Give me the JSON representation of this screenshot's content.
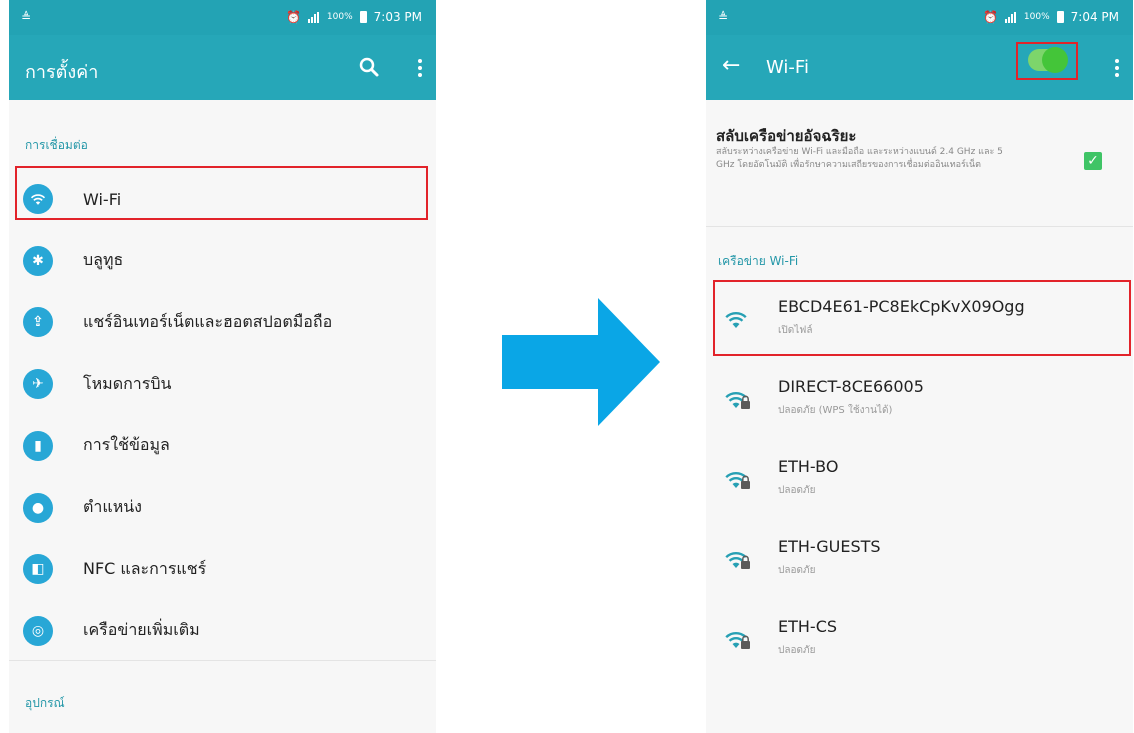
{
  "left": {
    "status_time": "7:03 PM",
    "battery": "100%",
    "title": "การตั้งค่า",
    "section_connections": "การเชื่อมต่อ",
    "items": [
      {
        "label": "Wi-Fi",
        "icon": "wifi-icon"
      },
      {
        "label": "บลูทูธ",
        "icon": "bluetooth-icon"
      },
      {
        "label": "แชร์อินเทอร์เน็ตและฮอตสปอตมือถือ",
        "icon": "tethering-icon"
      },
      {
        "label": "โหมดการบิน",
        "icon": "airplane-icon"
      },
      {
        "label": "การใช้ข้อมูล",
        "icon": "data-usage-icon"
      },
      {
        "label": "ตำแหน่ง",
        "icon": "location-icon"
      },
      {
        "label": "NFC และการแชร์",
        "icon": "nfc-icon"
      },
      {
        "label": "เครือข่ายเพิ่มเติม",
        "icon": "more-networks-icon"
      }
    ],
    "section_device": "อุปกรณ์"
  },
  "right": {
    "status_time": "7:04 PM",
    "battery": "100%",
    "title": "Wi-Fi",
    "wifi_enabled": true,
    "smart_switch": {
      "title": "สลับเครือข่ายอัจฉริยะ",
      "description": "สลับระหว่างเครือข่าย Wi-Fi และมือถือ และระหว่างแบนด์ 2.4 GHz และ 5 GHz โดยอัตโนมัติ เพื่อรักษาความเสถียรของการเชื่อมต่ออินเทอร์เน็ต",
      "checked": true
    },
    "section_networks": "เครือข่าย Wi-Fi",
    "networks": [
      {
        "name": "EBCD4E61-PC8EkCpKvX09Ogg",
        "status": "เปิดไฟล์",
        "secured": false
      },
      {
        "name": "DIRECT-8CE66005",
        "status": "ปลอดภัย (WPS ใช้งานได้)",
        "secured": true
      },
      {
        "name": "ETH-BO",
        "status": "ปลอดภัย",
        "secured": true
      },
      {
        "name": "ETH-GUESTS",
        "status": "ปลอดภัย",
        "secured": true
      },
      {
        "name": "ETH-CS",
        "status": "ปลอดภัย",
        "secured": true
      }
    ]
  },
  "colors": {
    "status_bar": "#23a3b4",
    "app_bar": "#26a7b8",
    "accent_text": "#2497a8",
    "icon_blue": "#28a7d6",
    "highlight_red": "#e2232a",
    "toggle_green": "#44c539",
    "arrow_blue": "#0aa6e6"
  }
}
